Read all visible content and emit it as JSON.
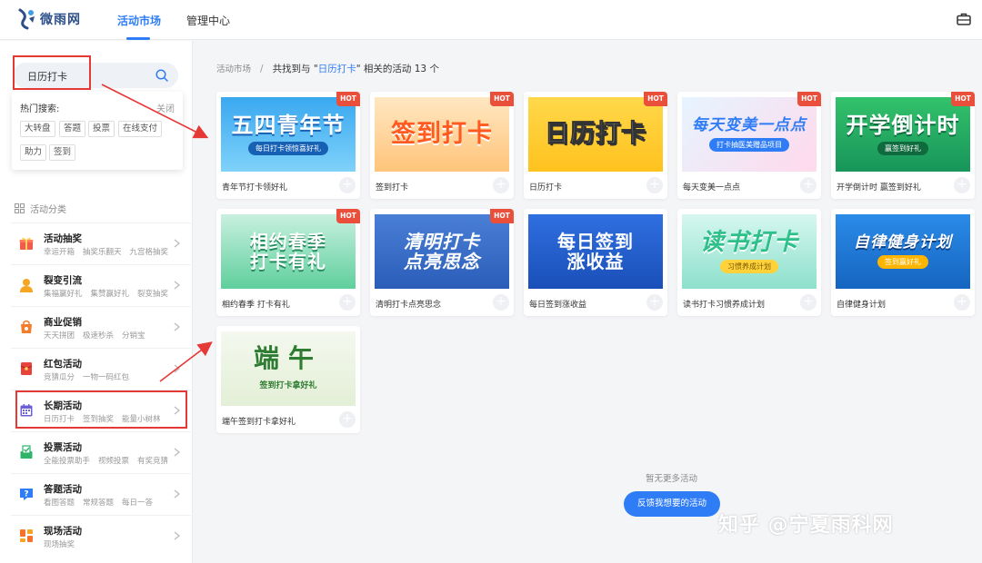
{
  "header": {
    "logo_text": "微雨网",
    "nav": [
      {
        "label": "活动市场",
        "active": true
      },
      {
        "label": "管理中心",
        "active": false
      }
    ]
  },
  "sidebar": {
    "search": {
      "value": "日历打卡"
    },
    "hot_search": {
      "title": "热门搜索:",
      "close_label": "关闭",
      "tags": [
        "大转盘",
        "答题",
        "投票",
        "在线支付",
        "助力",
        "签到"
      ]
    },
    "category_title": "活动分类",
    "categories": [
      {
        "name": "活动抽奖",
        "subs": [
          "幸运开箱",
          "抽奖乐翻天",
          "九宫格抽奖"
        ],
        "icon": "gift-icon"
      },
      {
        "name": "裂变引流",
        "subs": [
          "集福赢好礼",
          "集赞赢好礼",
          "裂变抽奖"
        ],
        "icon": "user-icon"
      },
      {
        "name": "商业促销",
        "subs": [
          "天天拼团",
          "极速秒杀",
          "分销宝"
        ],
        "icon": "shopping-bag-icon"
      },
      {
        "name": "红包活动",
        "subs": [
          "竞猜瓜分",
          "一物一码红包"
        ],
        "icon": "red-envelope-icon"
      },
      {
        "name": "长期活动",
        "subs": [
          "日历打卡",
          "签到抽奖",
          "能量小树林"
        ],
        "icon": "calendar-icon"
      },
      {
        "name": "投票活动",
        "subs": [
          "全能投票助手",
          "视频投票",
          "有奖竞猜"
        ],
        "icon": "vote-icon"
      },
      {
        "name": "答题活动",
        "subs": [
          "看图答题",
          "常规答题",
          "每日一答"
        ],
        "icon": "question-icon"
      },
      {
        "name": "现场活动",
        "subs": [
          "现场抽奖"
        ],
        "icon": "stage-icon"
      }
    ]
  },
  "main": {
    "breadcrumb": {
      "root": "活动市场",
      "separator": "/",
      "prefix": "共找到与 \"",
      "keyword": "日历打卡",
      "suffix": "\" 相关的活动 13 个"
    },
    "hot_label": "HOT",
    "cards": [
      {
        "title": "青年节打卡领好礼",
        "banner": "五四青年节",
        "banner_sub": "每日打卡领惊喜好礼",
        "hot": true
      },
      {
        "title": "签到打卡",
        "banner": "签到打卡",
        "banner_sub": "",
        "hot": true
      },
      {
        "title": "日历打卡",
        "banner": "日历打卡",
        "banner_sub": "",
        "hot": true
      },
      {
        "title": "每天变美一点点",
        "banner": "每天变美一点点",
        "banner_sub": "打卡抽医美赠品项目",
        "hot": true
      },
      {
        "title": "开学倒计时 赢签到好礼",
        "banner": "开学倒计时",
        "banner_sub": "赢签到好礼",
        "hot": true
      },
      {
        "title": "相约春季 打卡有礼",
        "banner": "相约春季\n打卡有礼",
        "banner_sub": "",
        "hot": true
      },
      {
        "title": "清明打卡点亮思念",
        "banner": "清明打卡\n点亮思念",
        "banner_sub": "",
        "hot": true
      },
      {
        "title": "每日签到涨收益",
        "banner": "每日签到\n涨收益",
        "banner_sub": "",
        "hot": false
      },
      {
        "title": "读书打卡习惯养成计划",
        "banner": "读书打卡",
        "banner_sub": "习惯养成计划",
        "hot": false
      },
      {
        "title": "自律健身计划",
        "banner": "自律健身计划",
        "banner_sub": "签到赢好礼",
        "hot": false
      },
      {
        "title": "端午签到打卡拿好礼",
        "banner": "端午",
        "banner_sub": "签到打卡拿好礼",
        "hot": false
      }
    ],
    "no_more": "暂无更多活动",
    "feedback_button": "反馈我想要的活动"
  },
  "watermark": "知乎 @宁夏雨科网",
  "colors": {
    "accent": "#2f7df6",
    "hot": "#e94f3a",
    "annotation": "#e53935"
  }
}
